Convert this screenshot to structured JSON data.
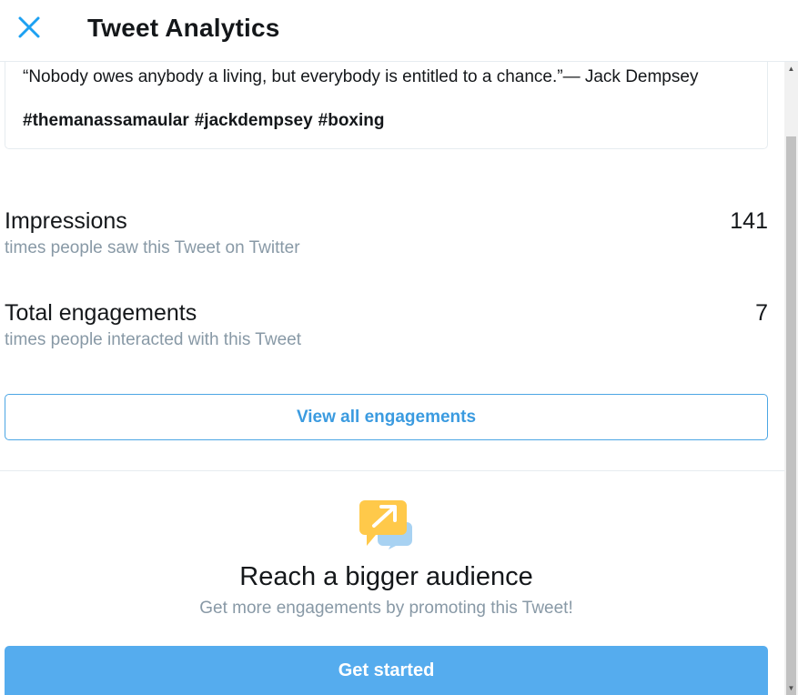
{
  "header": {
    "title": "Tweet Analytics",
    "close_icon": "close-icon"
  },
  "tweet": {
    "text": "“Nobody owes anybody a living, but everybody is entitled to a chance.”— Jack Dempsey",
    "hashtags": [
      "#themanassamaular",
      "#jackdempsey",
      "#boxing"
    ]
  },
  "metrics": [
    {
      "label": "Impressions",
      "value": "141",
      "description": "times people saw this Tweet on Twitter"
    },
    {
      "label": "Total engagements",
      "value": "7",
      "description": "times people interacted with this Tweet"
    }
  ],
  "actions": {
    "view_all_label": "View all engagements"
  },
  "promo": {
    "icon": "promote-speech-bubble-icon",
    "title": "Reach a bigger audience",
    "subtitle": "Get more engagements by promoting this Tweet!",
    "button_label": "Get started"
  },
  "colors": {
    "accent": "#55acee",
    "link": "#3b9be0",
    "muted_text": "#8899a6",
    "text": "#14171a",
    "promo_icon_yellow": "#ffc94a",
    "promo_icon_blue": "#a8d2f2"
  }
}
